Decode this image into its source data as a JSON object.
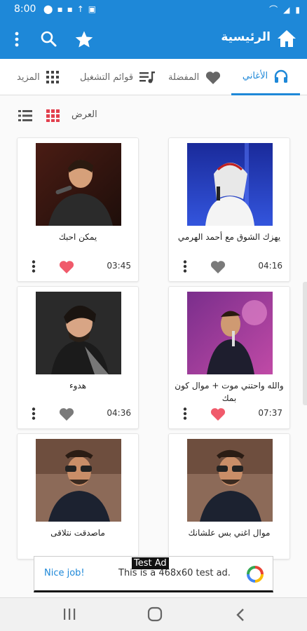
{
  "status_bar": {
    "time": "8:00"
  },
  "app_bar": {
    "title": "الرئيسية"
  },
  "tabs": [
    {
      "label": "الأغاني",
      "icon": "headphones-icon",
      "active": true
    },
    {
      "label": "المفضلة",
      "icon": "heart-icon",
      "active": false
    },
    {
      "label": "قوائم التشغيل",
      "icon": "playlist-icon",
      "active": false
    },
    {
      "label": "المزيد",
      "icon": "grid-icon",
      "active": false
    }
  ],
  "view": {
    "label": "العرض"
  },
  "songs": [
    {
      "title": "يهزك الشوق مع أحمد الهرمي",
      "duration": "04:16",
      "favorite": false
    },
    {
      "title": "يمكن احبك",
      "duration": "03:45",
      "favorite": true
    },
    {
      "title": "والله واحتني موت + موال كون بمك",
      "duration": "07:37",
      "favorite": true
    },
    {
      "title": "هدوء",
      "duration": "04:36",
      "favorite": false
    },
    {
      "title": "موال اغني بس علشانك",
      "duration": "",
      "favorite": false
    },
    {
      "title": "ماصدقت نتلاقى",
      "duration": "",
      "favorite": false
    }
  ],
  "ad": {
    "tag": "Test Ad",
    "left": "Nice job!",
    "body": "This is a 468x60 test ad."
  },
  "colors": {
    "primary": "#1e88d8",
    "heart_active": "#f05a6b",
    "heart_inactive": "#7a7a7a"
  }
}
